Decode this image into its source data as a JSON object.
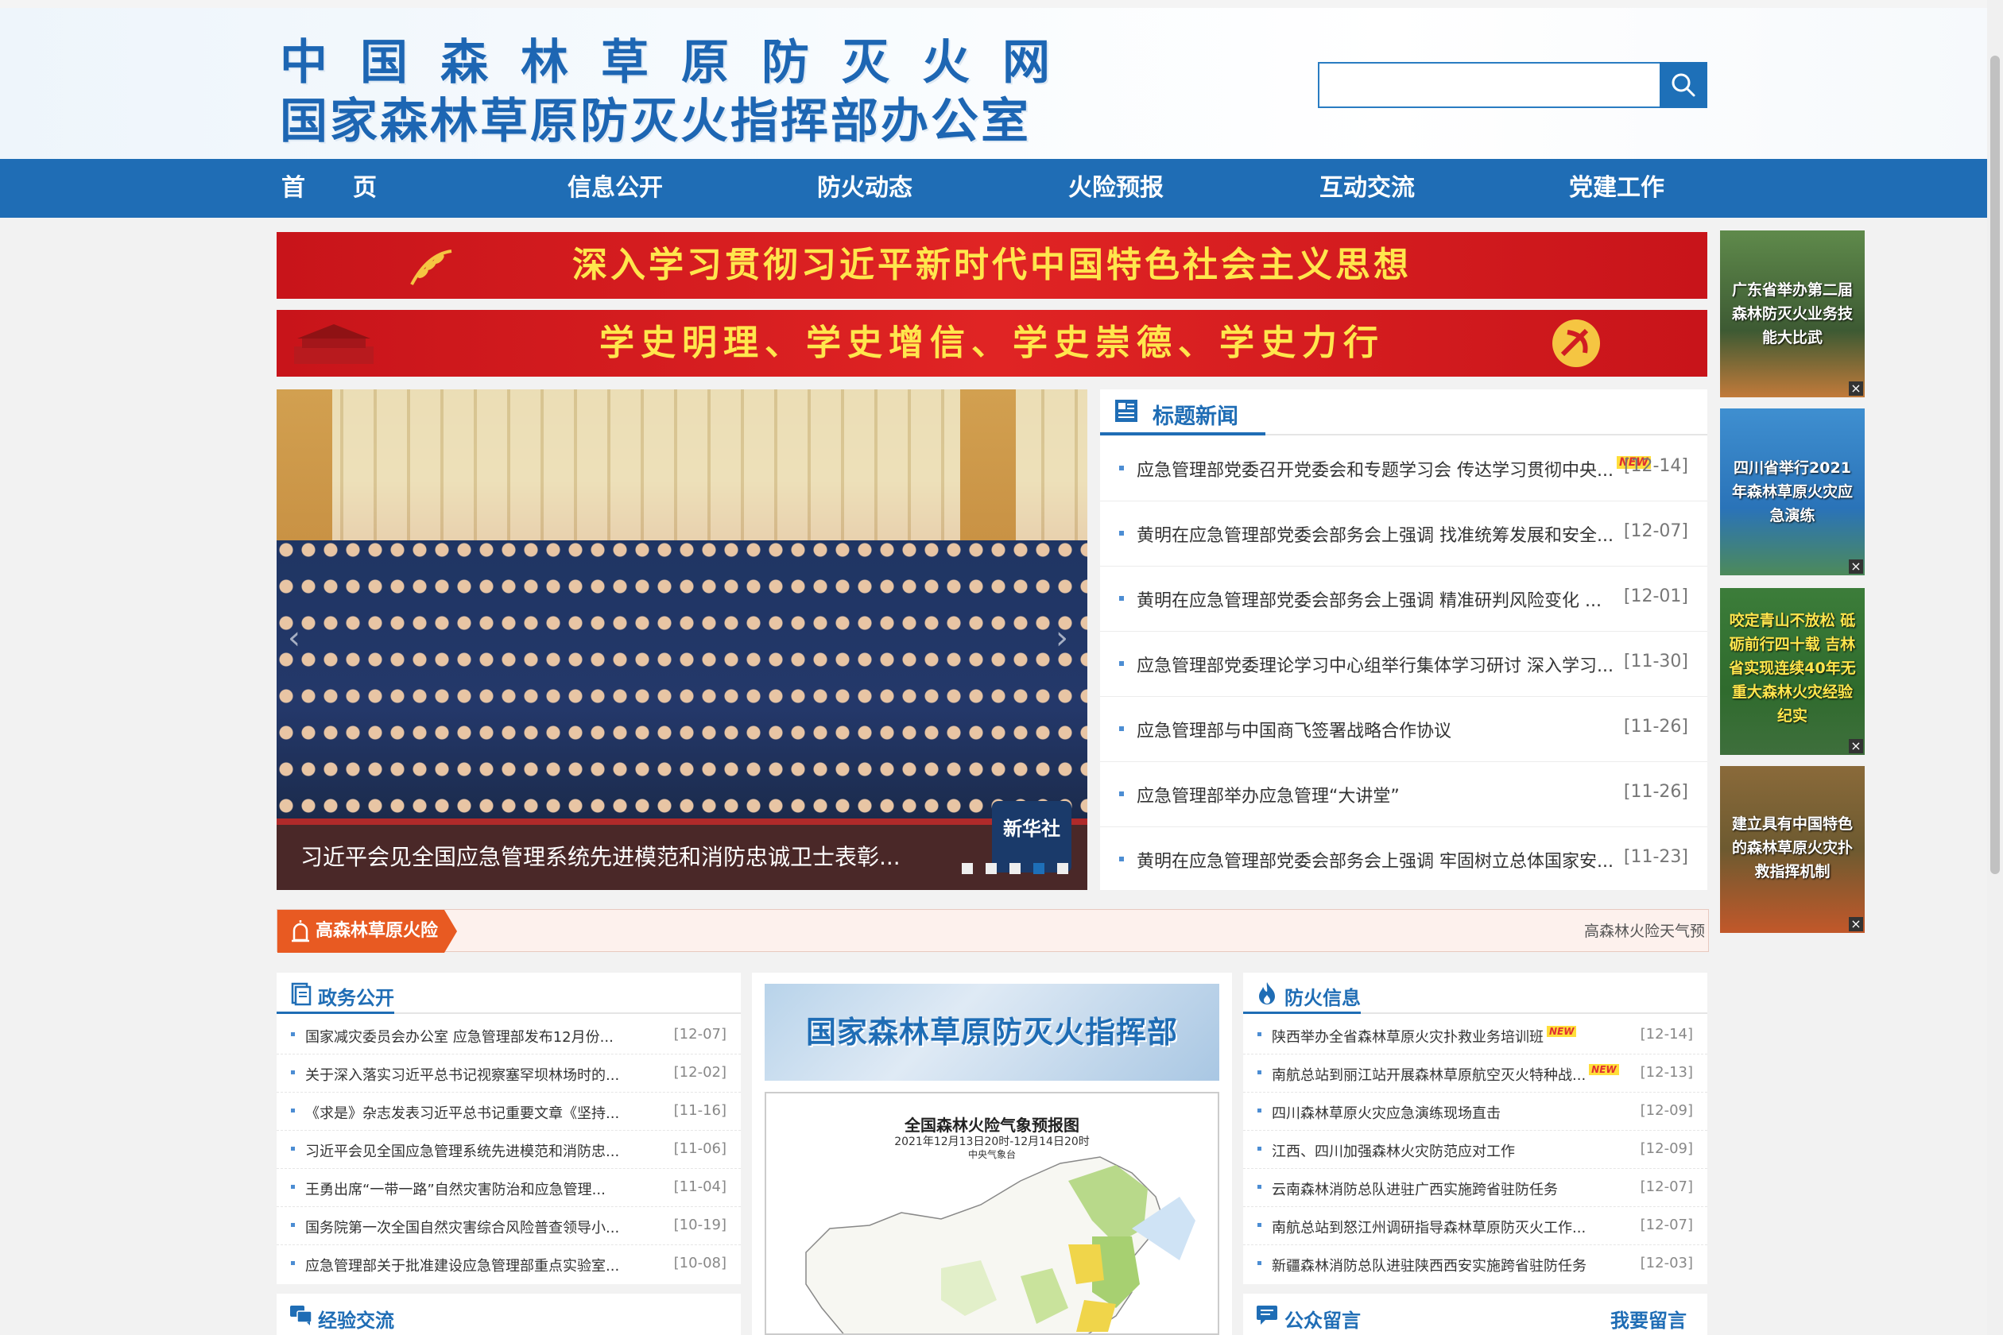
{
  "header": {
    "title": "中国森林草原防灭火网",
    "subtitle": "国家森林草原防灭火指挥部办公室",
    "search_placeholder": ""
  },
  "nav": {
    "items": [
      "首　　页",
      "信息公开",
      "防火动态",
      "火险预报",
      "互动交流",
      "党建工作"
    ]
  },
  "banners": {
    "banner1": "深入学习贯彻习近平新时代中国特色社会主义思想",
    "banner2": "学史明理、学史增信、学史崇德、学史力行"
  },
  "side_thumbs": [
    {
      "text": "广东省举办第二届森林防灭火业务技能大比武"
    },
    {
      "text": "四川省举行2021年森林草原火灾应急演练"
    },
    {
      "text": "咬定青山不放松 砥砺前行四十载 吉林省实现连续40年无重大森林火灾经验纪实"
    },
    {
      "text": "建立具有中国特色的森林草原火灾扑救指挥机制"
    }
  ],
  "carousel": {
    "caption": "习近平会见全国应急管理系统先进模范和消防忠诚卫士表彰...",
    "watermark": "新华社",
    "slide_count": 5,
    "active_index": 3
  },
  "headline_news": {
    "title": "标题新闻",
    "new_tag": "NEW",
    "items": [
      {
        "title": "应急管理部党委召开党委会和专题学习会 传达学习贯彻中央...",
        "date": "[12-14]",
        "is_new": true
      },
      {
        "title": "黄明在应急管理部党委会部务会上强调 找准统筹发展和安全...",
        "date": "[12-07]",
        "is_new": false
      },
      {
        "title": "黄明在应急管理部党委会部务会上强调 精准研判风险变化 ...",
        "date": "[12-01]",
        "is_new": false
      },
      {
        "title": "应急管理部党委理论学习中心组举行集体学习研讨 深入学习...",
        "date": "[11-30]",
        "is_new": false
      },
      {
        "title": "应急管理部与中国商飞签署战略合作协议",
        "date": "[11-26]",
        "is_new": false
      },
      {
        "title": "应急管理部举办应急管理“大讲堂”",
        "date": "[11-26]",
        "is_new": false
      },
      {
        "title": "黄明在应急管理部党委会部务会上强调 牢固树立总体国家安...",
        "date": "[11-23]",
        "is_new": false
      }
    ]
  },
  "fire_risk": {
    "label": "高森林草原火险",
    "scroll_text": "高森林火险天气预"
  },
  "gov_affairs": {
    "title": "政务公开",
    "items": [
      {
        "title": "国家减灾委员会办公室 应急管理部发布12月份...",
        "date": "[12-07]"
      },
      {
        "title": "关于深入落实习近平总书记视察塞罕坝林场时的...",
        "date": "[12-02]"
      },
      {
        "title": "《求是》杂志发表习近平总书记重要文章《坚持...",
        "date": "[11-16]"
      },
      {
        "title": "习近平会见全国应急管理系统先进模范和消防忠...",
        "date": "[11-06]"
      },
      {
        "title": "王勇出席“一带一路”自然灾害防治和应急管理...",
        "date": "[11-04]"
      },
      {
        "title": "国务院第一次全国自然灾害综合风险普查领导小...",
        "date": "[10-19]"
      },
      {
        "title": "应急管理部关于批准建设应急管理部重点实验室...",
        "date": "[10-08]"
      }
    ]
  },
  "experience": {
    "title": "经验交流"
  },
  "center": {
    "banner": "国家森林草原防灭火指挥部",
    "map_title": "全国森林火险气象预报图",
    "map_subtitle": "2021年12月13日20时-12月14日20时",
    "map_source": "中央气象台"
  },
  "fire_info": {
    "title": "防火信息",
    "items": [
      {
        "title": "陕西举办全省森林草原火灾扑救业务培训班",
        "date": "[12-14]",
        "is_new": true
      },
      {
        "title": "南航总站到丽江站开展森林草原航空灭火特种战...",
        "date": "[12-13]",
        "is_new": true
      },
      {
        "title": "四川森林草原火灾应急演练现场直击",
        "date": "[12-09]",
        "is_new": false
      },
      {
        "title": "江西、四川加强森林火灾防范应对工作",
        "date": "[12-09]",
        "is_new": false
      },
      {
        "title": "云南森林消防总队进驻广西实施跨省驻防任务",
        "date": "[12-07]",
        "is_new": false
      },
      {
        "title": "南航总站到怒江州调研指导森林草原防灭火工作...",
        "date": "[12-07]",
        "is_new": false
      },
      {
        "title": "新疆森林消防总队进驻陕西西安实施跨省驻防任务",
        "date": "[12-03]",
        "is_new": false
      }
    ]
  },
  "public_message": {
    "title": "公众留言",
    "button": "我要留言"
  },
  "colors": {
    "primary_blue": "#1f6db5",
    "banner_red": "#d01c22",
    "banner_yellow": "#ffe64d",
    "fire_orange": "#e85a22"
  }
}
